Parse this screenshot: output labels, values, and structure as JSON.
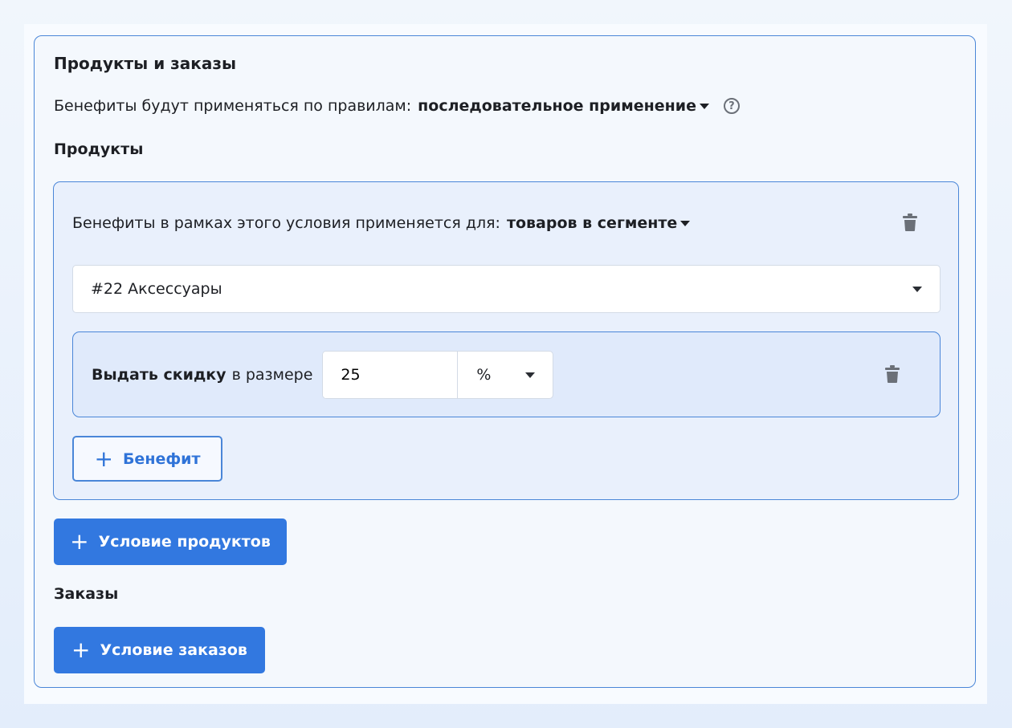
{
  "panel": {
    "title": "Продукты и заказы",
    "rules_prefix": "Бенефиты будут применяться по правилам:",
    "rules_value": "последовательное применение",
    "help_glyph": "?"
  },
  "products": {
    "heading": "Продукты",
    "condition": {
      "prefix": "Бенефиты в рамках этого условия применяется для:",
      "scope_value": "товаров в сегменте",
      "segment_value": "#22 Аксессуары",
      "benefit": {
        "action": "Выдать скидку",
        "middle": "в размере",
        "amount": "25",
        "unit": "%"
      },
      "add_benefit_label": "Бенефит"
    },
    "add_condition_label": "Условие продуктов"
  },
  "orders": {
    "heading": "Заказы",
    "add_condition_label": "Условие заказов"
  },
  "icons": {
    "plus": "+",
    "trash": "trash-icon",
    "caret": "caret-down-icon",
    "help": "question-circle-icon"
  },
  "colors": {
    "accent": "#3278e0",
    "border": "#4a86d8",
    "trash": "#6b7078"
  }
}
